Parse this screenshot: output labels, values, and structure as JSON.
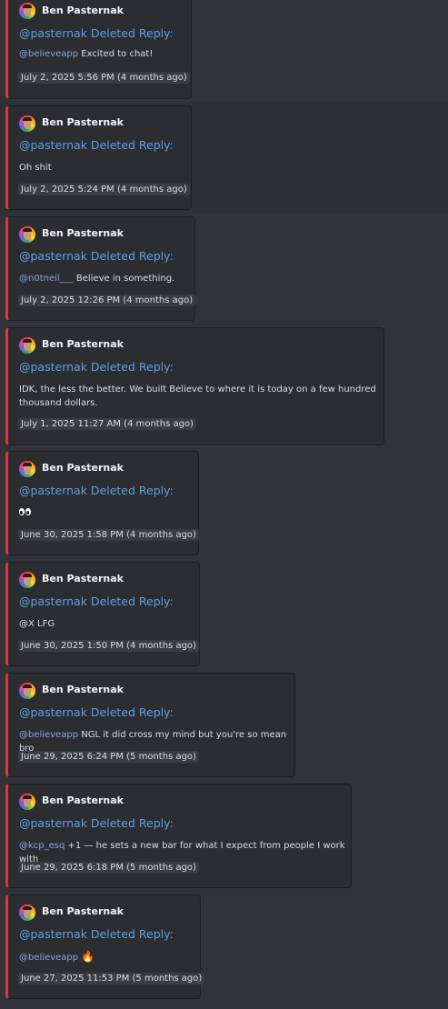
{
  "messages": [
    {
      "author": "Ben Pasternak",
      "reply_title": "@pasternak Deleted Reply:",
      "mention": "@believeapp",
      "text": " Excited to chat!",
      "timestamp": "July 2, 2025 5:56 PM",
      "relative": "(4 months ago)"
    },
    {
      "author": "Ben Pasternak",
      "reply_title": "@pasternak Deleted Reply:",
      "mention": "",
      "text": "Oh shit",
      "timestamp": "July 2, 2025 5:24 PM",
      "relative": "(4 months ago)"
    },
    {
      "author": "Ben Pasternak",
      "reply_title": "@pasternak Deleted Reply:",
      "mention": "@n0tneil___",
      "text": " Believe in something.",
      "timestamp": "July 2, 2025 12:26 PM",
      "relative": "(4 months ago)"
    },
    {
      "author": "Ben Pasternak",
      "reply_title": "@pasternak Deleted Reply:",
      "mention": "",
      "text_line1": "IDK, the less the better. We built Believe to where it is today on a few hundred",
      "text_line2": "thousand dollars.",
      "timestamp": "July 1, 2025 11:27 AM",
      "relative": "(4 months ago)"
    },
    {
      "author": "Ben Pasternak",
      "reply_title": "@pasternak Deleted Reply:",
      "emoji": "eyes-emoji",
      "timestamp": "June 30, 2025 1:58 PM",
      "relative": "(4 months ago)"
    },
    {
      "author": "Ben Pasternak",
      "reply_title": "@pasternak Deleted Reply:",
      "mention": "",
      "text": "@X LFG",
      "timestamp": "June 30, 2025 1:50 PM",
      "relative": "(4 months ago)"
    },
    {
      "author": "Ben Pasternak",
      "reply_title": "@pasternak Deleted Reply:",
      "mention": "@believeapp",
      "text": " NGL it did cross my mind but you're so mean bro",
      "timestamp": "June 29, 2025 6:24 PM",
      "relative": "(5 months ago)"
    },
    {
      "author": "Ben Pasternak",
      "reply_title": "@pasternak Deleted Reply:",
      "mention": "@kcp_esq",
      "text": " +1 — he sets a new bar for what I expect from people I work with",
      "timestamp": "June 29, 2025 6:18 PM",
      "relative": "(5 months ago)"
    },
    {
      "author": "Ben Pasternak",
      "reply_title": "@pasternak Deleted Reply:",
      "mention": "@believeapp",
      "emoji": "fire-emoji",
      "timestamp": "June 27, 2025 11:53 PM",
      "relative": "(5 months ago)"
    }
  ],
  "colors": {
    "background": "#313338",
    "card": "#2b2d31",
    "accent_bar": "#da373c",
    "reply_title": "#5c9fe8",
    "mention": "#7fa6e6"
  }
}
